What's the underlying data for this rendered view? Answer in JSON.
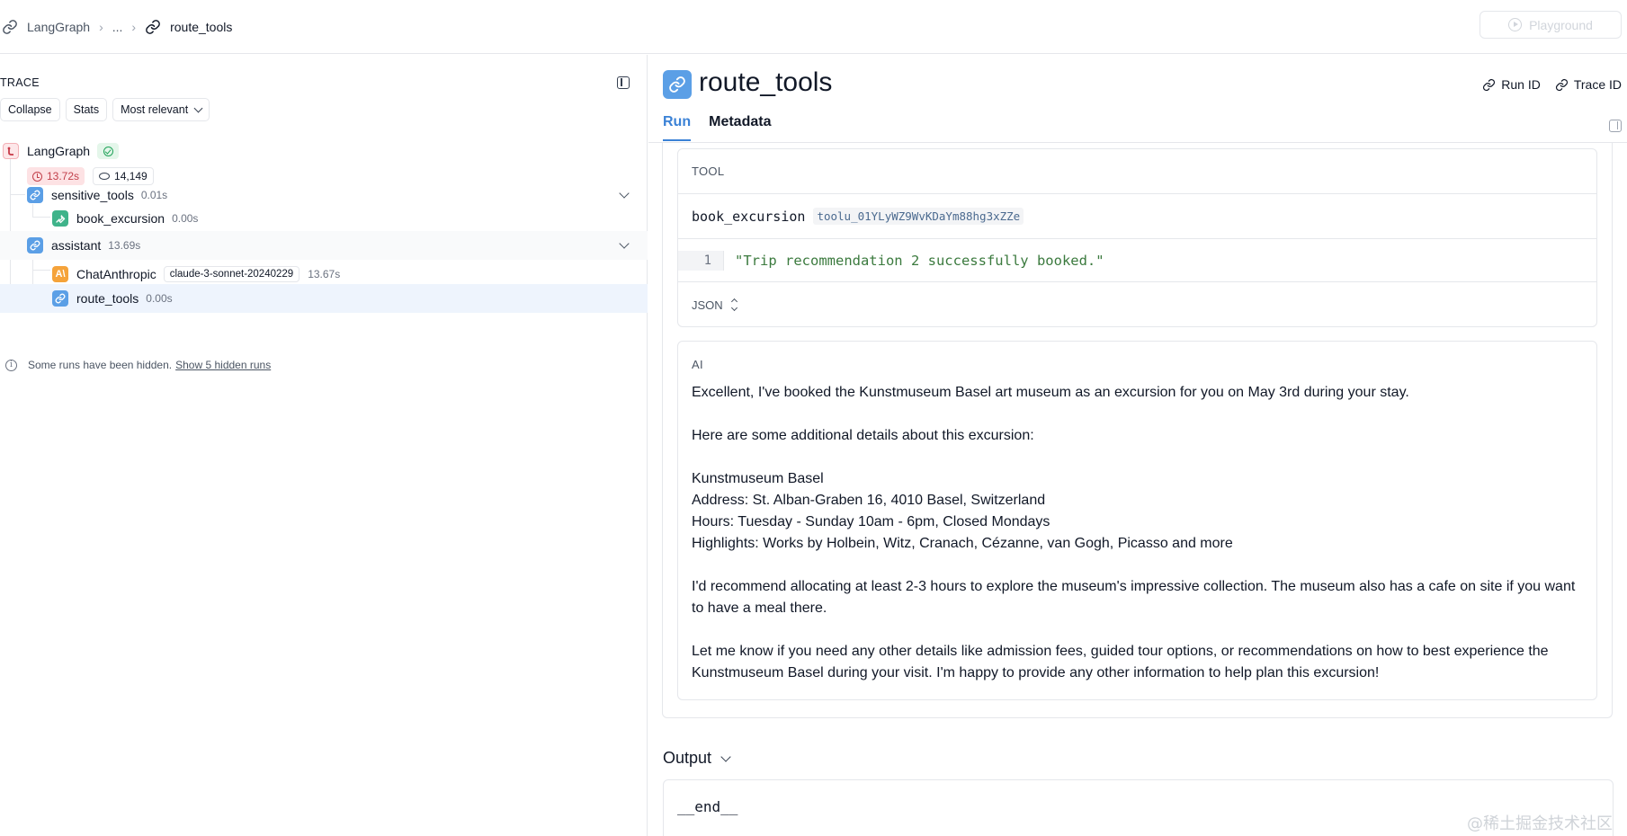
{
  "breadcrumb": {
    "root": "LangGraph",
    "ellipsis": "...",
    "current": "route_tools"
  },
  "toolbar": {
    "playground_label": "Playground"
  },
  "trace": {
    "title": "TRACE",
    "buttons": {
      "collapse": "Collapse",
      "stats": "Stats",
      "sort": "Most relevant"
    },
    "root": {
      "name": "LangGraph",
      "status": "success",
      "latency": "13.72s",
      "tokens": "14,149"
    },
    "nodes": [
      {
        "name": "sensitive_tools",
        "time": "0.01s",
        "icon": "link-icon",
        "expanded": true
      },
      {
        "name": "book_excursion",
        "time": "0.00s",
        "icon": "wrench-icon"
      },
      {
        "name": "assistant",
        "time": "13.69s",
        "icon": "link-icon",
        "expanded": true
      },
      {
        "name": "ChatAnthropic",
        "model": "claude-3-sonnet-20240229",
        "time": "13.67s",
        "icon": "anthropic-icon"
      },
      {
        "name": "route_tools",
        "time": "0.00s",
        "icon": "link-icon",
        "selected": true
      }
    ],
    "hidden_note": "Some runs have been hidden.",
    "hidden_link": "Show 5 hidden runs"
  },
  "run": {
    "title": "route_tools",
    "run_id_label": "Run ID",
    "trace_id_label": "Trace ID",
    "tabs": [
      "Run",
      "Metadata"
    ],
    "active_tab": "Run",
    "tool_card": {
      "label": "TOOL",
      "tool_name": "book_excursion",
      "tool_call_id": "toolu_01YLyWZ9WvKDaYm88hg3xZZe",
      "line_number": "1",
      "content": "\"Trip recommendation 2 successfully booked.\"",
      "format": "JSON"
    },
    "ai_card": {
      "label": "AI",
      "p1": "Excellent, I've booked the Kunstmuseum Basel art museum as an excursion for you on May 3rd during your stay.",
      "p2": "Here are some additional details about this excursion:",
      "l1": "Kunstmuseum Basel",
      "l2": "Address: St. Alban-Graben 16, 4010 Basel, Switzerland",
      "l3": "Hours: Tuesday - Sunday 10am - 6pm, Closed Mondays",
      "l4": "Highlights: Works by Holbein, Witz, Cranach, Cézanne, van Gogh, Picasso and more",
      "p4": "I'd recommend allocating at least 2-3 hours to explore the museum's impressive collection. The museum also has a cafe on site if you want to have a meal there.",
      "p5": "Let me know if you need any other details like admission fees, guided tour options, or recommendations on how to best experience the Kunstmuseum Basel during your visit. I'm happy to provide any other information to help plan this excursion!"
    },
    "output": {
      "label": "Output",
      "value": "__end__"
    }
  },
  "watermark": "@稀土掘金技术社区",
  "colors": {
    "accent": "#3b82d6",
    "link_icon_bg": "#5b9fe6",
    "tool_icon_bg": "#3fb38a",
    "anthropic_icon_bg": "#f5a33a",
    "latency_bg": "#fde2e4",
    "selected_row": "#eef4fd"
  }
}
